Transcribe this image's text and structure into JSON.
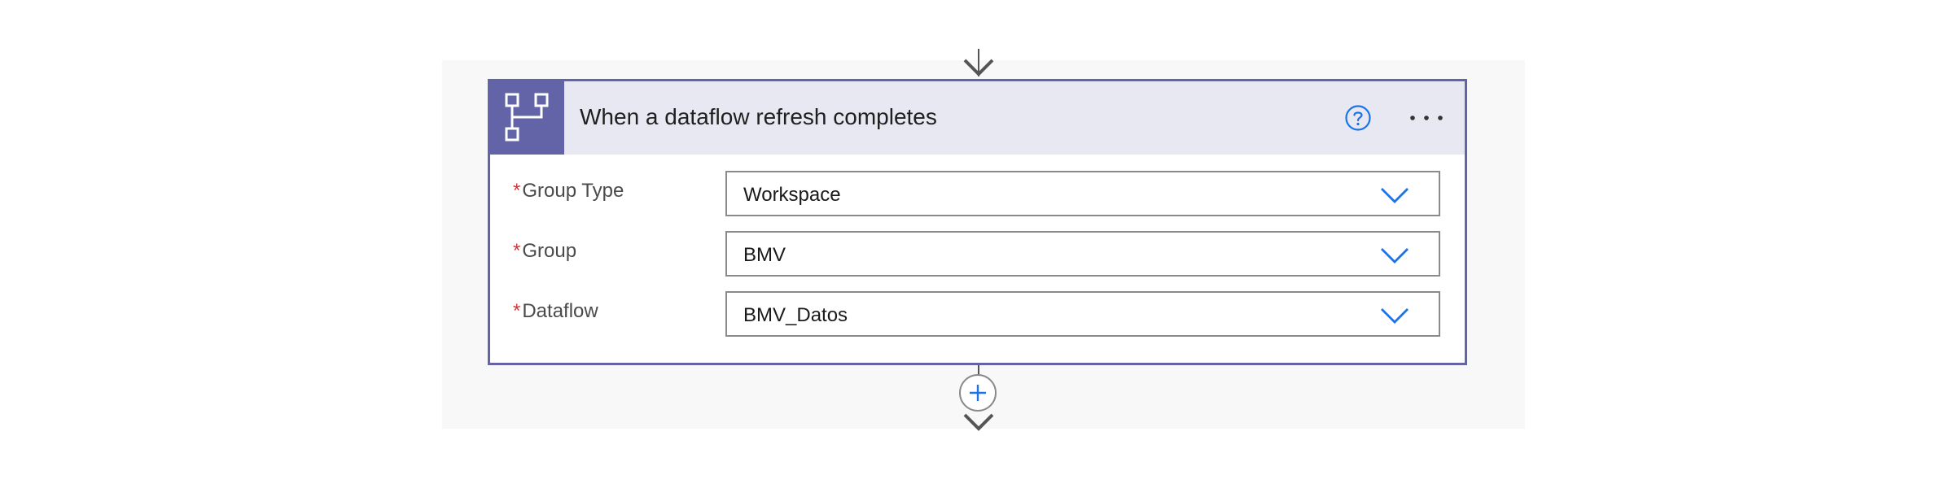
{
  "trigger": {
    "title": "When a dataflow refresh completes",
    "icon": "dataflow-icon",
    "accent_color": "#6264a7",
    "header_bg": "#e8e8f2",
    "help_icon": "help-circle-icon",
    "more_icon": "more-options-icon"
  },
  "fields": [
    {
      "label": "Group Type",
      "required": true,
      "value": "Workspace"
    },
    {
      "label": "Group",
      "required": true,
      "value": "BMV"
    },
    {
      "label": "Dataflow",
      "required": true,
      "value": "BMV_Datos"
    }
  ],
  "connectors": {
    "add_step_icon": "plus-icon",
    "arrow_icon": "arrow-down-icon"
  },
  "colors": {
    "required_marker": "#d13438",
    "link_blue": "#1a73e8"
  }
}
